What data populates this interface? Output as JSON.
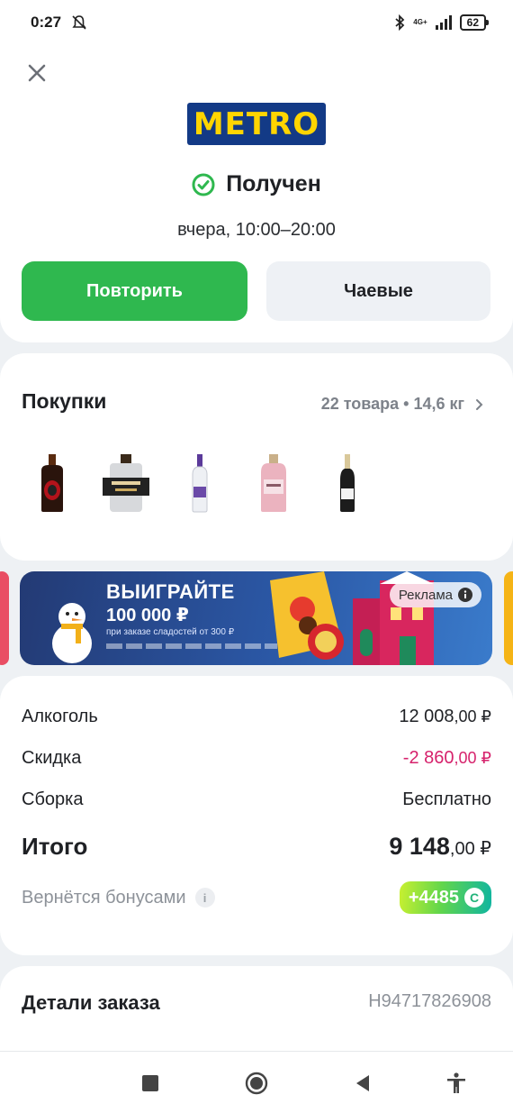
{
  "status_bar": {
    "time": "0:27",
    "network": "4G+",
    "battery": "62",
    "icons": [
      "notifications-off-icon",
      "bluetooth-icon",
      "signal-icon",
      "battery-icon"
    ]
  },
  "header": {
    "close_icon": "close-icon",
    "store_logo": "METRO",
    "order_status": "Получен",
    "status_icon": "check-circle-icon",
    "delivery_time": "вчера, 10:00–20:00",
    "repeat_button": "Повторить",
    "tips_button": "Чаевые"
  },
  "purchases": {
    "title": "Покупки",
    "summary": "22 товара • 14,6 кг",
    "products": [
      {
        "name": "rum-bottle",
        "color": "#3a1a10"
      },
      {
        "name": "gin-bottle",
        "color": "#2a2a2a"
      },
      {
        "name": "vodka-bottle",
        "color": "#6b4aa8"
      },
      {
        "name": "pink-gin-bottle",
        "color": "#e7a7b3"
      },
      {
        "name": "sparkling-wine-bottle",
        "color": "#1c1c1c"
      }
    ]
  },
  "banner": {
    "headline": "ВЫИГРАЙТЕ",
    "amount": "100 000 ₽",
    "subtitle": "при заказе сладостей от 300 ₽",
    "ad_label": "Реклама"
  },
  "summary": {
    "alcohol_label": "Алкоголь",
    "alcohol_int": "12 008",
    "alcohol_frac": ",00 ₽",
    "discount_label": "Скидка",
    "discount_int": "-2 860",
    "discount_frac": ",00 ₽",
    "assembly_label": "Сборка",
    "assembly_value": "Бесплатно",
    "total_label": "Итого",
    "total_int": "9 148",
    "total_frac": ",00 ₽",
    "bonus_label": "Вернётся бонусами",
    "bonus_value": "+4485",
    "colors": {
      "discount": "#d6226c",
      "repeat_button": "#2fb84f"
    }
  },
  "details": {
    "title": "Детали заказа",
    "order_number": "H94717826908"
  },
  "nav": {
    "icons": [
      "recent-apps-icon",
      "home-icon",
      "back-icon",
      "accessibility-icon"
    ]
  }
}
